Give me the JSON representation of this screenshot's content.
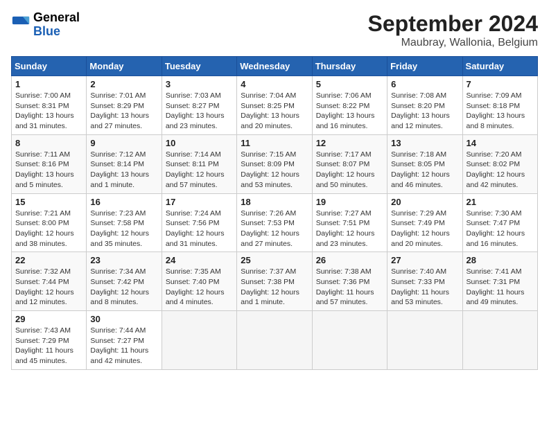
{
  "header": {
    "logo_general": "General",
    "logo_blue": "Blue",
    "month": "September 2024",
    "location": "Maubray, Wallonia, Belgium"
  },
  "weekdays": [
    "Sunday",
    "Monday",
    "Tuesday",
    "Wednesday",
    "Thursday",
    "Friday",
    "Saturday"
  ],
  "weeks": [
    [
      {
        "day": "1",
        "sunrise": "7:00 AM",
        "sunset": "8:31 PM",
        "daylight": "13 hours and 31 minutes."
      },
      {
        "day": "2",
        "sunrise": "7:01 AM",
        "sunset": "8:29 PM",
        "daylight": "13 hours and 27 minutes."
      },
      {
        "day": "3",
        "sunrise": "7:03 AM",
        "sunset": "8:27 PM",
        "daylight": "13 hours and 23 minutes."
      },
      {
        "day": "4",
        "sunrise": "7:04 AM",
        "sunset": "8:25 PM",
        "daylight": "13 hours and 20 minutes."
      },
      {
        "day": "5",
        "sunrise": "7:06 AM",
        "sunset": "8:22 PM",
        "daylight": "13 hours and 16 minutes."
      },
      {
        "day": "6",
        "sunrise": "7:08 AM",
        "sunset": "8:20 PM",
        "daylight": "13 hours and 12 minutes."
      },
      {
        "day": "7",
        "sunrise": "7:09 AM",
        "sunset": "8:18 PM",
        "daylight": "13 hours and 8 minutes."
      }
    ],
    [
      {
        "day": "8",
        "sunrise": "7:11 AM",
        "sunset": "8:16 PM",
        "daylight": "13 hours and 5 minutes."
      },
      {
        "day": "9",
        "sunrise": "7:12 AM",
        "sunset": "8:14 PM",
        "daylight": "13 hours and 1 minute."
      },
      {
        "day": "10",
        "sunrise": "7:14 AM",
        "sunset": "8:11 PM",
        "daylight": "12 hours and 57 minutes."
      },
      {
        "day": "11",
        "sunrise": "7:15 AM",
        "sunset": "8:09 PM",
        "daylight": "12 hours and 53 minutes."
      },
      {
        "day": "12",
        "sunrise": "7:17 AM",
        "sunset": "8:07 PM",
        "daylight": "12 hours and 50 minutes."
      },
      {
        "day": "13",
        "sunrise": "7:18 AM",
        "sunset": "8:05 PM",
        "daylight": "12 hours and 46 minutes."
      },
      {
        "day": "14",
        "sunrise": "7:20 AM",
        "sunset": "8:02 PM",
        "daylight": "12 hours and 42 minutes."
      }
    ],
    [
      {
        "day": "15",
        "sunrise": "7:21 AM",
        "sunset": "8:00 PM",
        "daylight": "12 hours and 38 minutes."
      },
      {
        "day": "16",
        "sunrise": "7:23 AM",
        "sunset": "7:58 PM",
        "daylight": "12 hours and 35 minutes."
      },
      {
        "day": "17",
        "sunrise": "7:24 AM",
        "sunset": "7:56 PM",
        "daylight": "12 hours and 31 minutes."
      },
      {
        "day": "18",
        "sunrise": "7:26 AM",
        "sunset": "7:53 PM",
        "daylight": "12 hours and 27 minutes."
      },
      {
        "day": "19",
        "sunrise": "7:27 AM",
        "sunset": "7:51 PM",
        "daylight": "12 hours and 23 minutes."
      },
      {
        "day": "20",
        "sunrise": "7:29 AM",
        "sunset": "7:49 PM",
        "daylight": "12 hours and 20 minutes."
      },
      {
        "day": "21",
        "sunrise": "7:30 AM",
        "sunset": "7:47 PM",
        "daylight": "12 hours and 16 minutes."
      }
    ],
    [
      {
        "day": "22",
        "sunrise": "7:32 AM",
        "sunset": "7:44 PM",
        "daylight": "12 hours and 12 minutes."
      },
      {
        "day": "23",
        "sunrise": "7:34 AM",
        "sunset": "7:42 PM",
        "daylight": "12 hours and 8 minutes."
      },
      {
        "day": "24",
        "sunrise": "7:35 AM",
        "sunset": "7:40 PM",
        "daylight": "12 hours and 4 minutes."
      },
      {
        "day": "25",
        "sunrise": "7:37 AM",
        "sunset": "7:38 PM",
        "daylight": "12 hours and 1 minute."
      },
      {
        "day": "26",
        "sunrise": "7:38 AM",
        "sunset": "7:36 PM",
        "daylight": "11 hours and 57 minutes."
      },
      {
        "day": "27",
        "sunrise": "7:40 AM",
        "sunset": "7:33 PM",
        "daylight": "11 hours and 53 minutes."
      },
      {
        "day": "28",
        "sunrise": "7:41 AM",
        "sunset": "7:31 PM",
        "daylight": "11 hours and 49 minutes."
      }
    ],
    [
      {
        "day": "29",
        "sunrise": "7:43 AM",
        "sunset": "7:29 PM",
        "daylight": "11 hours and 45 minutes."
      },
      {
        "day": "30",
        "sunrise": "7:44 AM",
        "sunset": "7:27 PM",
        "daylight": "11 hours and 42 minutes."
      },
      null,
      null,
      null,
      null,
      null
    ]
  ]
}
